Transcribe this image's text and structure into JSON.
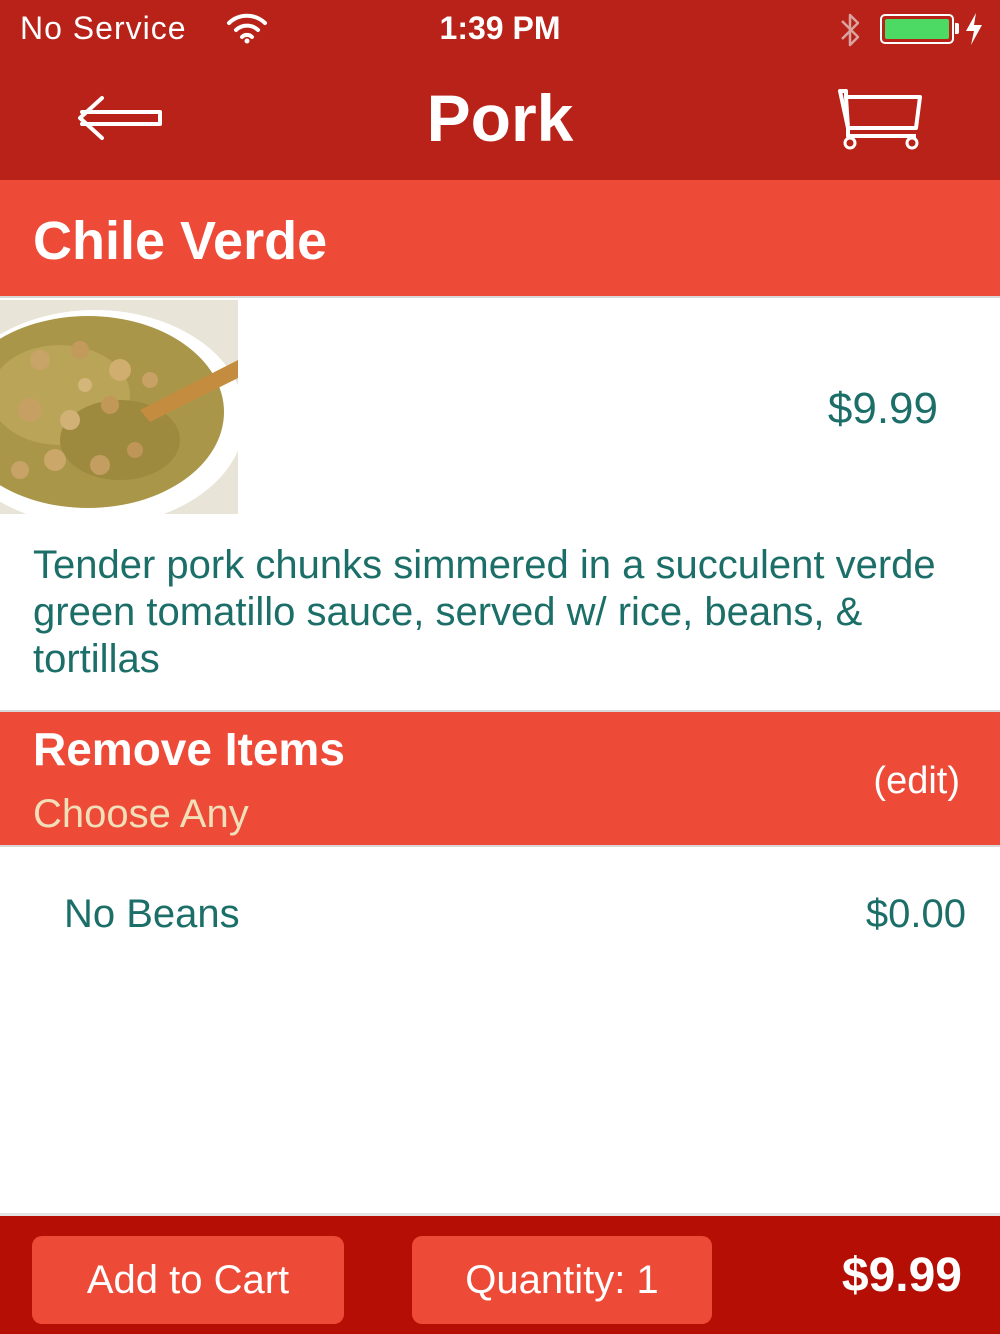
{
  "status_bar": {
    "carrier": "No Service",
    "time": "1:39 PM",
    "battery_color": "#4cd964"
  },
  "nav": {
    "title": "Pork",
    "back_icon": "back-arrow-icon",
    "cart_icon": "cart-icon"
  },
  "item": {
    "name": "Chile Verde",
    "price": "$9.99",
    "description": "Tender pork chunks simmered in a succulent verde green tomatillo sauce, served w/ rice, beans, & tortillas"
  },
  "modifier_section": {
    "title": "Remove Items",
    "subtitle": "Choose Any",
    "edit_label": "(edit)",
    "options": [
      {
        "label": "No Beans",
        "price": "$0.00"
      }
    ]
  },
  "footer": {
    "add_label": "Add to Cart",
    "quantity_label": "Quantity: 1",
    "total": "$9.99"
  },
  "colors": {
    "nav_bar": "#b82218",
    "accent": "#ee4a38",
    "text_teal": "#1c6e68",
    "subtitle": "#f1dfb9",
    "footer": "#b50f05"
  }
}
